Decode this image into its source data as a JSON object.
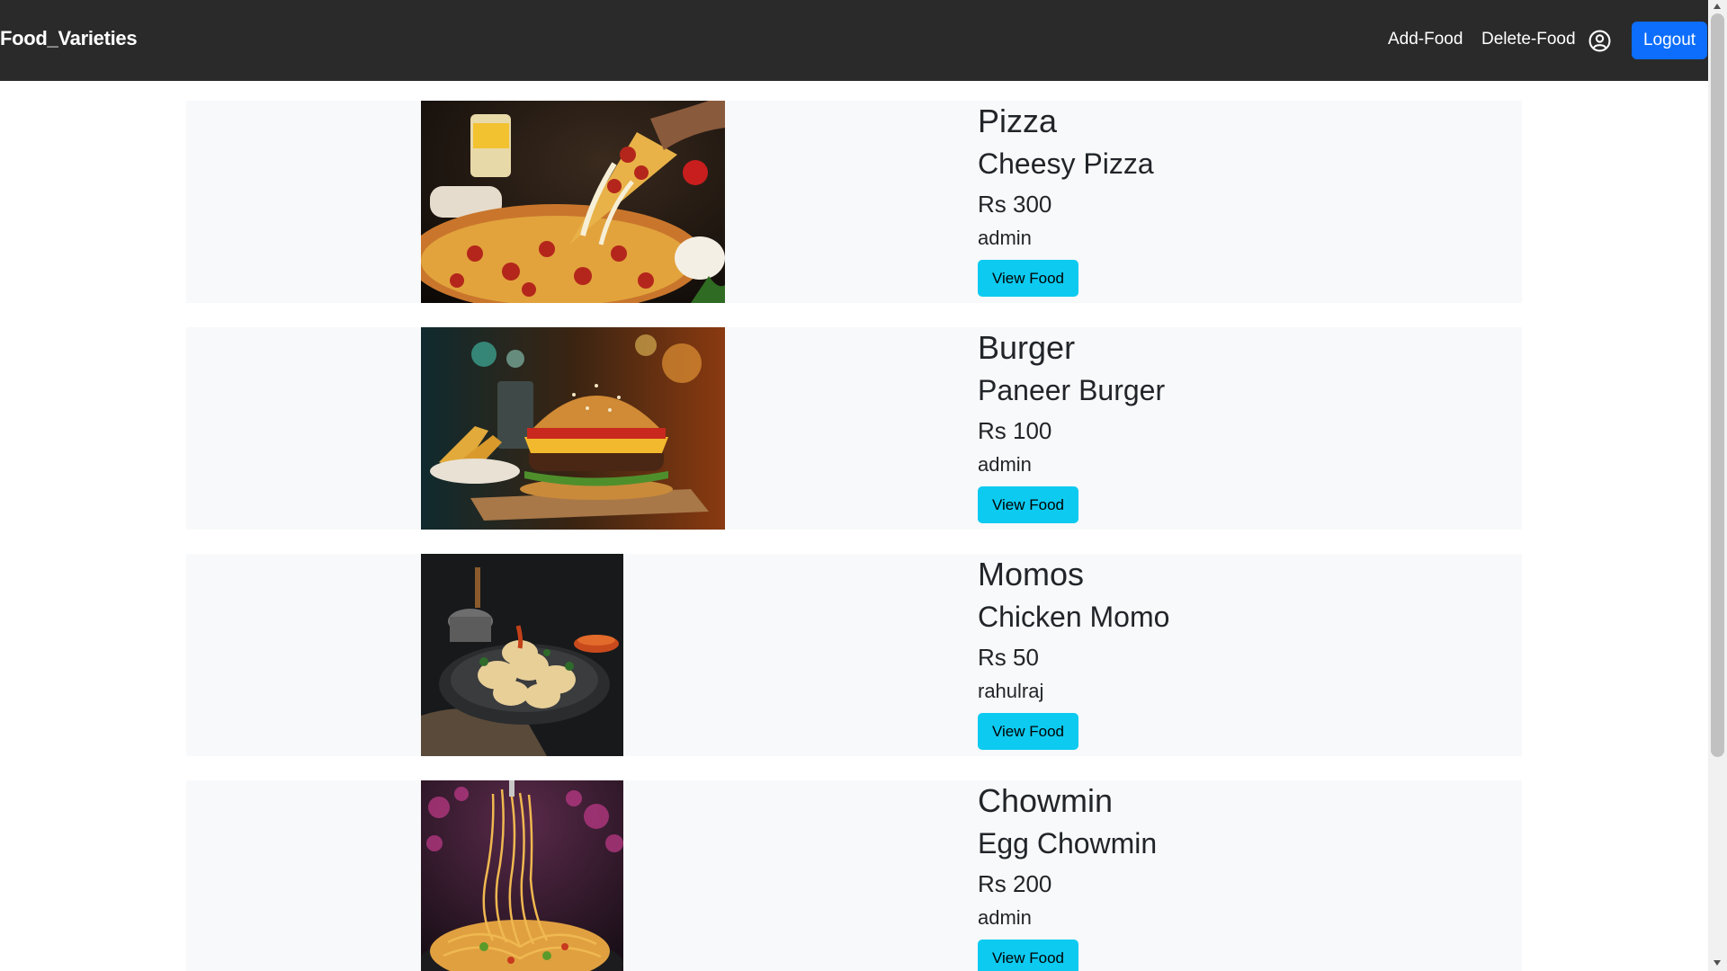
{
  "nav": {
    "brand": "Food_Varieties",
    "add_food": "Add-Food",
    "delete_food": "Delete-Food",
    "user_icon": "user-circle-icon",
    "logout": "Logout"
  },
  "foods": [
    {
      "category": "Pizza",
      "name": "Cheesy Pizza",
      "price": "Rs 300",
      "user": "admin",
      "button": "View Food",
      "image": "pizza-image"
    },
    {
      "category": "Burger",
      "name": "Paneer Burger",
      "price": "Rs 100",
      "user": "admin",
      "button": "View Food",
      "image": "burger-image"
    },
    {
      "category": "Momos",
      "name": "Chicken Momo",
      "price": "Rs 50",
      "user": "rahulraj",
      "button": "View Food",
      "image": "momos-image"
    },
    {
      "category": "Chowmin",
      "name": "Egg Chowmin",
      "price": "Rs 200",
      "user": "admin",
      "button": "View Food",
      "image": "chowmin-image"
    }
  ],
  "colors": {
    "navbar": "#2b2a2a",
    "logout_button": "#0d6efd",
    "view_button": "#0dcaf0",
    "card_background": "#f8f9fa"
  }
}
